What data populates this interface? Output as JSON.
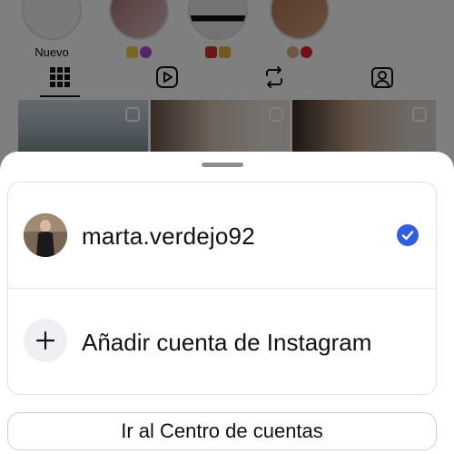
{
  "stories": [
    {
      "label": "Nuevo",
      "emojis": []
    },
    {
      "label": "",
      "emojis": [
        "sparkle-emoji",
        "purple-heart-emoji"
      ]
    },
    {
      "label": "",
      "emojis": [
        "red-book-emoji",
        "writing-hand-emoji"
      ]
    },
    {
      "label": "",
      "emojis": [
        "dog-face-emoji",
        "red-heart-emoji"
      ]
    }
  ],
  "profile_tabs": [
    {
      "icon": "grid-icon",
      "active": true
    },
    {
      "icon": "reels-icon",
      "active": false
    },
    {
      "icon": "reposts-icon",
      "active": false
    },
    {
      "icon": "tagged-icon",
      "active": false
    }
  ],
  "sheet": {
    "account": {
      "username": "marta.verdejo92",
      "selected": true,
      "check_icon": "checkmark-icon"
    },
    "add_account": {
      "label": "Añadir cuenta de Instagram",
      "icon": "plus-icon"
    },
    "accounts_center_button": "Ir al Centro de cuentas"
  },
  "colors": {
    "accent": "#2f5fe0",
    "overlay": "rgba(0,0,0,0.5)"
  }
}
